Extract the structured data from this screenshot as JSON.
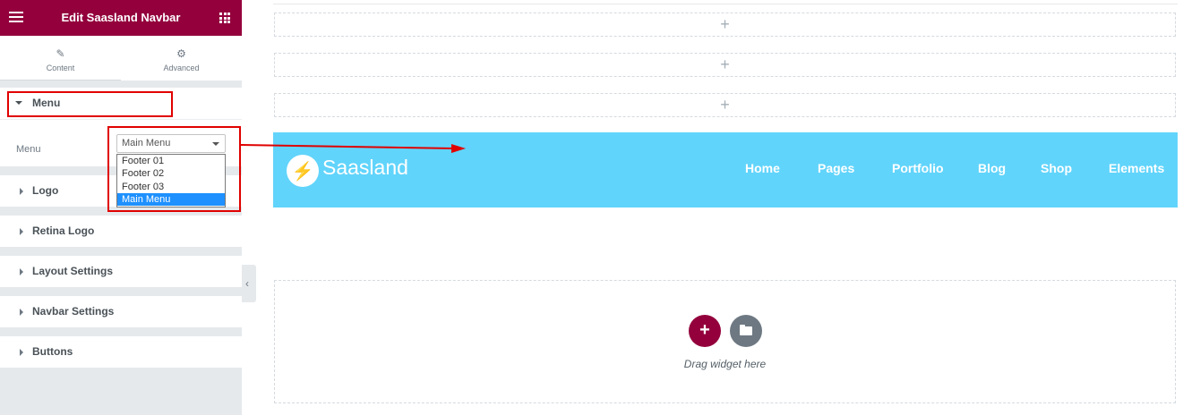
{
  "panel": {
    "title": "Edit Saasland Navbar",
    "tabs": [
      {
        "label": "Content",
        "icon": "pencil-icon"
      },
      {
        "label": "Advanced",
        "icon": "gear-icon"
      }
    ],
    "sections": {
      "menu": "Menu",
      "logo": "Logo",
      "retina_logo": "Retina Logo",
      "layout_settings": "Layout Settings",
      "navbar_settings": "Navbar Settings",
      "buttons": "Buttons"
    },
    "menu_control": {
      "label": "Menu",
      "selected": "Main Menu",
      "options": [
        "Footer 01",
        "Footer 02",
        "Footer 03",
        "Main Menu"
      ]
    }
  },
  "preview": {
    "logo_text": "Saasland",
    "nav_links": [
      "Home",
      "Pages",
      "Portfolio",
      "Blog",
      "Shop",
      "Elements"
    ],
    "drag_text": "Drag widget here",
    "add_symbol": "+",
    "empty_row_symbol": "+"
  },
  "colors": {
    "panel_header": "#93003c",
    "navbar_bg": "#61d4fb",
    "highlight": "#e00000",
    "selected_option": "#1e90ff"
  }
}
